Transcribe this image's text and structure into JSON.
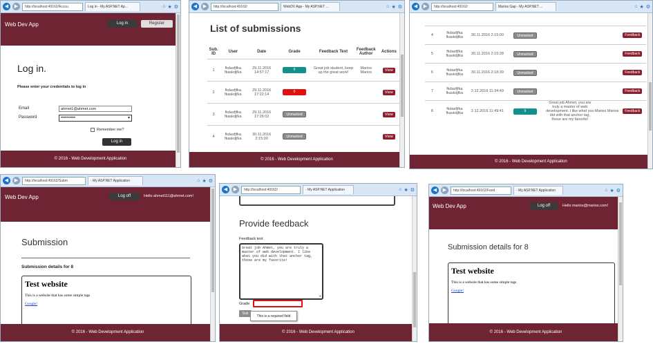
{
  "colors": {
    "header": "#6e2433",
    "accent": "#8a1f2e",
    "teal": "#12908e",
    "red": "#e01010"
  },
  "p1": {
    "address": "http://localhost:49162/Accou",
    "tab": "Log in - My ASP.NET Ap...",
    "brand": "Web Dev App",
    "login_btn": "Log in",
    "register_btn": "Register",
    "title": "Log in.",
    "subtitle": "Please enter your credentials to log in",
    "email_label": "Email",
    "email_value": "ahmet1@ahmet.com",
    "password_label": "Password",
    "password_value": "••••••••••",
    "remember_label": "Remember me?",
    "submit": "Log in",
    "footer": "© 2016 - Web Development Application"
  },
  "p2": {
    "address": "http://localhost:49162/",
    "tab": "WebDV App - My ASP.NET ...",
    "title": "List of submissions",
    "headers": [
      "Sub. ID",
      "User",
      "Date",
      "Grade",
      "Feedback Text",
      "Feedback Author",
      "Actions"
    ],
    "rows": [
      {
        "id": "1",
        "user": "fkdasfjfka fkaskdjfka",
        "date": "29.11.2016 14:57:17",
        "grade": "9",
        "grade_kind": "teal",
        "fb": "Great job student, keep up the great work!",
        "author": "Marios Marios",
        "action": "View"
      },
      {
        "id": "2",
        "user": "fkdasfjfka fkaskdjfka",
        "date": "29.11.2016 17:22:14",
        "grade": "0",
        "grade_kind": "red",
        "fb": "",
        "author": "",
        "action": "View"
      },
      {
        "id": "3",
        "user": "fkdasfjfka fkaskdjfka",
        "date": "29.11.2016 17:26:02",
        "grade": "Unmarked",
        "grade_kind": "unm",
        "fb": "",
        "author": "",
        "action": "View"
      },
      {
        "id": "4",
        "user": "fkdasfjfka fkaskdjfka",
        "date": "30.11.2016 2:15:00",
        "grade": "Unmarked",
        "grade_kind": "unm",
        "fb": "",
        "author": "",
        "action": "View"
      }
    ],
    "footer": "© 2016 - Web Development Application"
  },
  "p3": {
    "address": "http://localhost:49162/",
    "tab": "Marios Gap - My ASP.NET ...",
    "rows": [
      {
        "id": "4",
        "user": "fkdasfjfka fkaskdjfka",
        "date": "30.11.2016 2:15:00",
        "grade": "Unmarked",
        "grade_kind": "unm",
        "fb": "",
        "author": "",
        "action": "Feedback"
      },
      {
        "id": "5",
        "user": "fkdasfjfka fkaskdjfka",
        "date": "30.11.2016 2:15:28",
        "grade": "Unmarked",
        "grade_kind": "unm",
        "fb": "",
        "author": "",
        "action": "Feedback"
      },
      {
        "id": "6",
        "user": "fkdasfjfka fkaskdjfka",
        "date": "30.11.2016 2:18:39",
        "grade": "Unmarked",
        "grade_kind": "unm",
        "fb": "",
        "author": "",
        "action": "Feedback"
      },
      {
        "id": "7",
        "user": "fkdasfjfka fkaskdjfka",
        "date": "2.12.2016 11:34:49",
        "grade": "Unmarked",
        "grade_kind": "unm",
        "fb": "",
        "author": "",
        "action": "Feedback"
      },
      {
        "id": "8",
        "user": "fkdasfjfka fkaskdjfka",
        "date": "2.12.2016 11:49:41",
        "grade": "9",
        "grade_kind": "teal",
        "fb": "Great job Ahmet, you are truly a master of web development. I like what you did with that anchor tag, those are my favorite!",
        "author": "Marios Marios",
        "action": "Feedback"
      }
    ],
    "footer": "© 2016 - Web Development Application"
  },
  "p4": {
    "address": "http://localhost:49162/Subm",
    "tab": "- My ASP.NET Application",
    "brand": "Web Dev App",
    "logoff": "Log off",
    "hello": "Hello ahmet111@ahmet.com!",
    "title": "Submission",
    "details": "Submission details for 8",
    "site_title": "Test website",
    "site_desc": "This is a website that has some simple tags",
    "site_link": "Google!",
    "footer": "© 2016 - Web Development Application"
  },
  "p5": {
    "address": "http://localhost:49162/",
    "tab": "- My ASP.NET Application",
    "title": "Provide feedback",
    "fb_label": "Feedback text",
    "fb_text": "Great job Ahmet, you are truly a master of web development. I like what you did with that anchor tag, those are my favorite!",
    "grade_label": "Grade",
    "submit": "Sub",
    "tooltip": "This is a required field",
    "footer": "© 2016 - Web Development Application"
  },
  "p6": {
    "address": "http://localhost:49162/Feed",
    "tab": "- My ASP.NET Application",
    "brand": "Web Dev App",
    "logoff": "Log off",
    "hello": "Hello marios@marios.com!",
    "title": "Submission details for 8",
    "site_title": "Test website",
    "site_desc": "This is a website that has some simple tags",
    "site_link": "Google!",
    "footer": "© 2016 - Web Development Application"
  }
}
